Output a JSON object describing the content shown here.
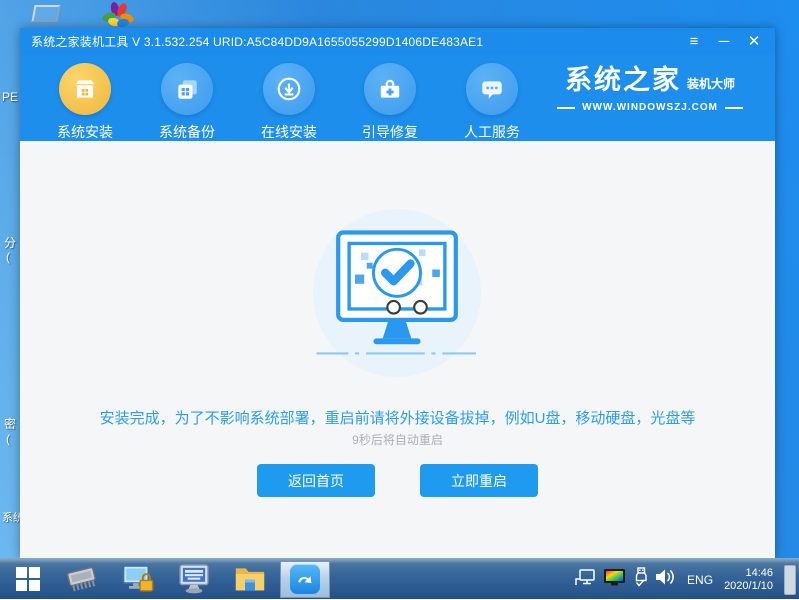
{
  "window": {
    "title": "系统之家装机工具 V 3.1.532.254 URID:A5C84DD9A1655055299D1406DE483AE1",
    "controls": {
      "menu": "≡",
      "minimize": "─",
      "close": "✕"
    }
  },
  "nav": {
    "items": [
      {
        "label": "系统安装",
        "icon": "install-box-icon",
        "active": true
      },
      {
        "label": "系统备份",
        "icon": "backup-copies-icon",
        "active": false
      },
      {
        "label": "在线安装",
        "icon": "download-circle-icon",
        "active": false
      },
      {
        "label": "引导修复",
        "icon": "repair-toolbox-icon",
        "active": false
      },
      {
        "label": "人工服务",
        "icon": "chat-bubble-icon",
        "active": false
      }
    ],
    "logo": {
      "title": "系统之家",
      "subtitle": "装机大师",
      "url": "WWW.WINDOWSZJ.COM"
    }
  },
  "main": {
    "illustration": "monitor-checkmark-success",
    "message": "安装完成，为了不影响系统部署，重启前请将外接设备拔掉，例如U盘，移动硬盘，光盘等",
    "countdown": "9秒后将自动重启",
    "buttons": [
      {
        "label": "返回首页"
      },
      {
        "label": "立即重启"
      }
    ]
  },
  "desktop": {
    "labels": [
      "PE",
      "分",
      "(",
      "密",
      "(",
      "系统"
    ],
    "icons": [
      "monitor-outline-icon",
      "flower-logo-icon"
    ]
  },
  "taskbar": {
    "icons": [
      "start-icon",
      "memory-chip-icon",
      "monitor-lock-icon",
      "keyboard-monitor-icon",
      "folder-icon",
      "installer-app-icon"
    ],
    "tray_icons": [
      "network-icon",
      "color-display-icon",
      "usb-icon",
      "volume-icon"
    ],
    "language": "ENG",
    "time": "14:46",
    "date": "2020/1/10"
  },
  "colors": {
    "header_blue": "#1b8ceb",
    "accent_blue": "#2b98f0",
    "button_blue": "#1e9bef",
    "active_gold": "#f0b73c",
    "content_bg": "#f5f6f7",
    "message_blue": "#2d9cf2",
    "countdown_gray": "#aab0b5"
  }
}
